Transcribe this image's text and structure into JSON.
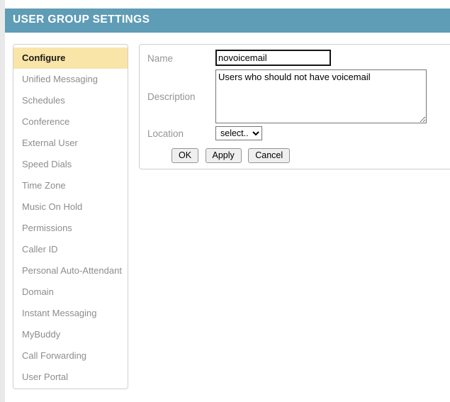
{
  "header": {
    "title": "USER GROUP SETTINGS",
    "bar_color": "#5f9cb6",
    "text_color": "#ffffff"
  },
  "sidebar": {
    "active_index": 0,
    "active_background": "#fae5a8",
    "items": [
      {
        "label": "Configure"
      },
      {
        "label": "Unified Messaging"
      },
      {
        "label": "Schedules"
      },
      {
        "label": "Conference"
      },
      {
        "label": "External User"
      },
      {
        "label": "Speed Dials"
      },
      {
        "label": "Time Zone"
      },
      {
        "label": "Music On Hold"
      },
      {
        "label": "Permissions"
      },
      {
        "label": "Caller ID"
      },
      {
        "label": "Personal Auto-Attendant"
      },
      {
        "label": "Domain"
      },
      {
        "label": "Instant Messaging"
      },
      {
        "label": "MyBuddy"
      },
      {
        "label": "Call Forwarding"
      },
      {
        "label": "User Portal"
      }
    ]
  },
  "form": {
    "name": {
      "label": "Name",
      "value": "novoicemail",
      "placeholder": ""
    },
    "description": {
      "label": "Description",
      "value": "Users who should not have voicemail",
      "placeholder": ""
    },
    "location": {
      "label": "Location",
      "selected": "select...",
      "options": [
        "select..."
      ]
    },
    "buttons": {
      "ok": "OK",
      "apply": "Apply",
      "cancel": "Cancel"
    }
  }
}
